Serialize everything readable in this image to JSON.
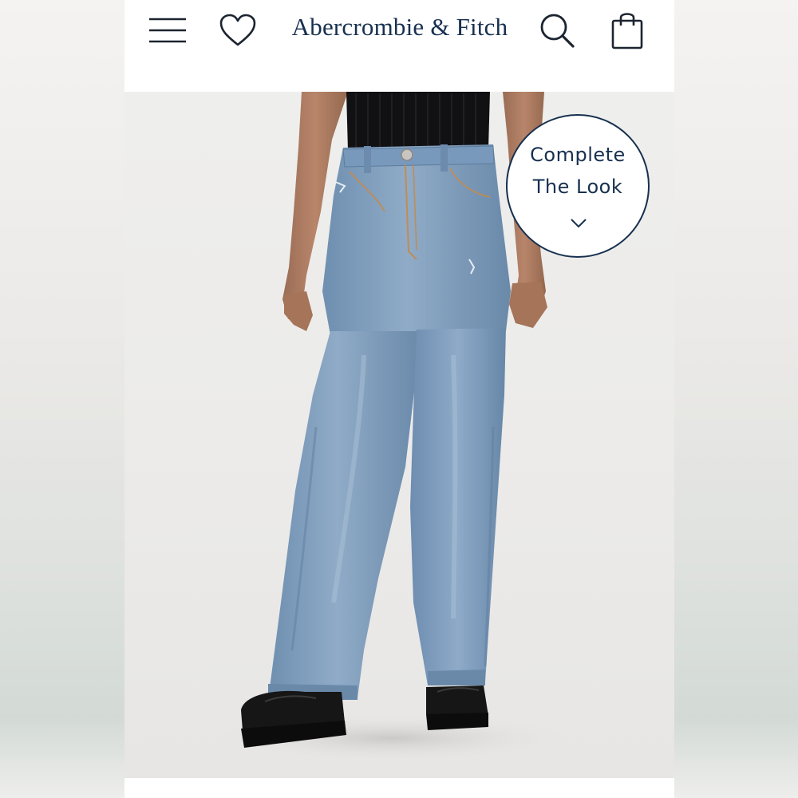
{
  "header": {
    "brand": "Abercrombie & Fitch",
    "menu_icon": "hamburger-menu-icon",
    "wishlist_icon": "heart-icon",
    "search_icon": "search-icon",
    "bag_icon": "shopping-bag-icon"
  },
  "product": {
    "image_icon": "product-photo-jeans",
    "complete_look": {
      "line1": "Complete",
      "line2": "The Look",
      "icon": "chevron-down-icon"
    }
  },
  "colors": {
    "brand_navy": "#17304f",
    "denim": "#7b9bbd",
    "background": "#ffffff"
  }
}
